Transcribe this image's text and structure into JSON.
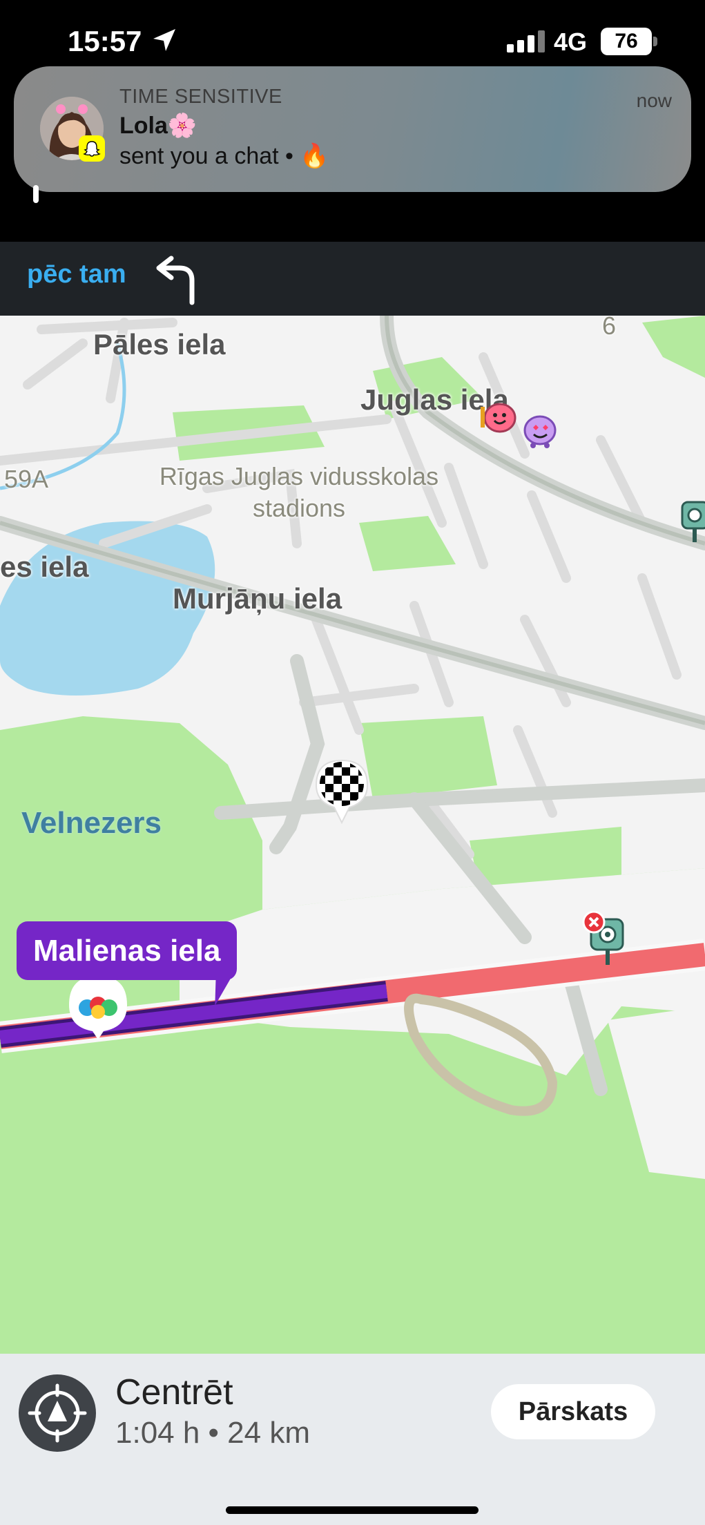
{
  "status_bar": {
    "time": "15:57",
    "network": "4G",
    "battery": "76"
  },
  "notification": {
    "kicker": "TIME SENSITIVE",
    "sender": "Lola🌸",
    "message": "sent you a chat • 🔥",
    "time": "now",
    "app_icon": "snapchat-ghost-icon"
  },
  "next_instruction": {
    "label": "pēc tam",
    "maneuver_icon": "turn-left-icon"
  },
  "map": {
    "streets": {
      "pales": "Pāles iela",
      "juglas": "Juglas iela",
      "murjanu": "Murjāņu iela",
      "es_iela": "es iela",
      "house_59a": "59A",
      "number_6": "6"
    },
    "poi_stadium": [
      "Rīgas Juglas vidusskolas",
      "stadions"
    ],
    "lake": "Velnezers",
    "current_street": "Malienas iela",
    "colors": {
      "route": "#7526c7",
      "traffic": "#f16a6f",
      "park": "#b4ea9e",
      "water": "#a4d8ee",
      "road": "#ffffff"
    }
  },
  "bottom_bar": {
    "title": "Centrēt",
    "eta": "1:04 h • 24 km",
    "overview_button": "Pārskats"
  }
}
